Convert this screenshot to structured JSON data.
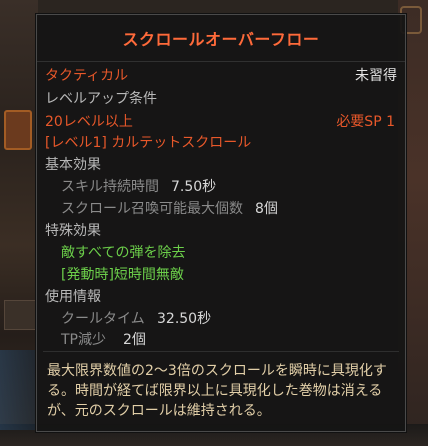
{
  "tooltip": {
    "title": "スクロールオーバーフロー",
    "category": "タクティカル",
    "learned_status": "未習得",
    "requirements_label": "レベルアップ条件",
    "level_req": "20レベル以上",
    "sp_req": "必要SP 1",
    "prereq_skill": "[レベル1] カルテットスクロール",
    "basic_effect_label": "基本効果",
    "duration_label": "スキル持続時間",
    "duration_value": "7.50秒",
    "max_scroll_label": "スクロール召喚可能最大個数",
    "max_scroll_value": "8個",
    "special_effect_label": "特殊効果",
    "special_effect_1": "敵すべての弾を除去",
    "special_effect_2": "[発動時]短時間無敵",
    "usage_label": "使用情報",
    "cooldown_label": "クールタイム",
    "cooldown_value": "32.50秒",
    "tp_label": "TP減少",
    "tp_value": "2個",
    "description": "最大限界数値の2～3倍のスクロールを瞬時に具現化する。時間が経てば限界以上に具現化した巻物は消えるが、元のスクロールは維持される。"
  },
  "colors": {
    "title": "#ff6a3a",
    "requirement": "#e8582a",
    "special": "#6ccf4a",
    "description": "#e2cfa8"
  }
}
